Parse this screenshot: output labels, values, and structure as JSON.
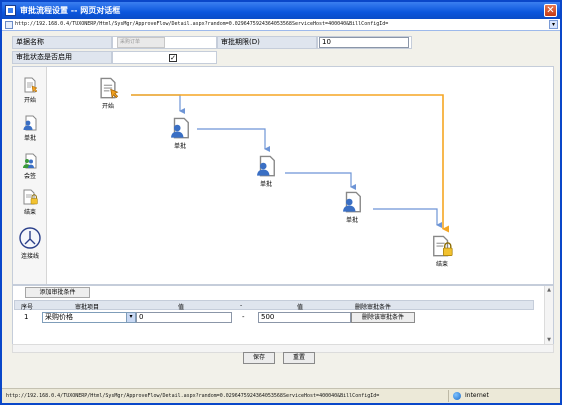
{
  "window": {
    "title": "审批流程设置 -- 网页对话框",
    "url": "http://192.168.0.4/TUXONERP/Html/SysMgr/ApproveFlow/Detail.aspx?random=0.0296475924364053568ServiceHost=400040&BillConfigId=",
    "close_glyph": "✕"
  },
  "form": {
    "name_label": "单据名称",
    "name_value": "采购订单",
    "limit_label": "审批期限(D)",
    "limit_value": "10",
    "enabled_label": "审批状态是否启用",
    "enabled_checked": true,
    "check_glyph": "✓"
  },
  "toolbox": [
    {
      "name": "start",
      "label": "开始",
      "icon": "start-icon"
    },
    {
      "name": "single",
      "label": "单批",
      "icon": "user-doc-icon"
    },
    {
      "name": "joint",
      "label": "会签",
      "icon": "users-doc-icon"
    },
    {
      "name": "end",
      "label": "结束",
      "icon": "lock-doc-icon"
    },
    {
      "name": "connector",
      "label": "连接线",
      "icon": "connector-icon"
    }
  ],
  "flow": {
    "nodes": [
      {
        "id": "start",
        "label": "开始",
        "icon": "start-icon"
      },
      {
        "id": "a1",
        "label": "单批",
        "icon": "user-doc-icon"
      },
      {
        "id": "a2",
        "label": "单批",
        "icon": "user-doc-icon"
      },
      {
        "id": "a3",
        "label": "单批",
        "icon": "user-doc-icon"
      },
      {
        "id": "end",
        "label": "结束",
        "icon": "lock-doc-icon"
      }
    ],
    "colors": {
      "line_blue": "#6e95d6",
      "line_orange": "#f5a623"
    }
  },
  "conditions": {
    "add_button": "添加审批条件",
    "headers": {
      "index": "序号",
      "item": "审批项目",
      "value": "值",
      "dash": "-",
      "value2": "值",
      "delete": "删除审批条件"
    },
    "rows": [
      {
        "index": "1",
        "item": "采购价格",
        "from": "0",
        "dash": "-",
        "to": "500",
        "delete_button": "删除该审批条件"
      }
    ]
  },
  "footer": {
    "save": "保存",
    "reset": "重置"
  },
  "status": {
    "url": "http://192.168.0.4/TUXONERP/Html/SysMgr/ApproveFlow/Detail.aspx?random=0.0296475924364053568ServiceHost=400040&BillConfigId=",
    "zone": "Internet"
  }
}
